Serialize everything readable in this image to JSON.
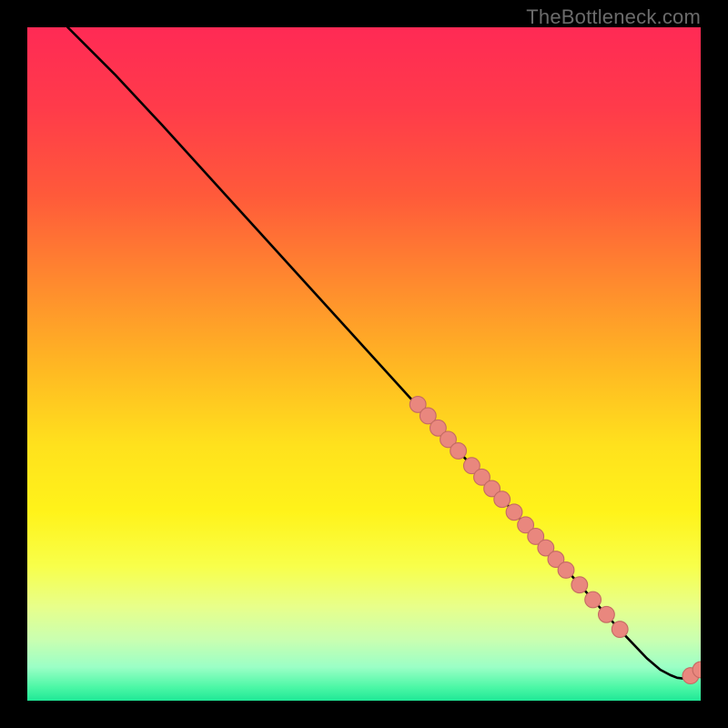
{
  "attribution": "TheBottleneck.com",
  "colors": {
    "background": "#000000",
    "gradient_stops": [
      {
        "offset": 0.0,
        "color": "#ff2a55"
      },
      {
        "offset": 0.12,
        "color": "#ff3b4a"
      },
      {
        "offset": 0.25,
        "color": "#ff5a3a"
      },
      {
        "offset": 0.38,
        "color": "#ff8a2e"
      },
      {
        "offset": 0.5,
        "color": "#ffb623"
      },
      {
        "offset": 0.62,
        "color": "#ffe11d"
      },
      {
        "offset": 0.72,
        "color": "#fff31a"
      },
      {
        "offset": 0.8,
        "color": "#f8ff4a"
      },
      {
        "offset": 0.86,
        "color": "#e8ff8a"
      },
      {
        "offset": 0.91,
        "color": "#c9ffb1"
      },
      {
        "offset": 0.95,
        "color": "#9bffc6"
      },
      {
        "offset": 0.98,
        "color": "#4cf7a6"
      },
      {
        "offset": 1.0,
        "color": "#1fe896"
      }
    ],
    "curve": "#000000",
    "dot_fill": "#e9877e",
    "dot_stroke": "#c46a63"
  },
  "chart_data": {
    "type": "line",
    "title": "",
    "xlabel": "",
    "ylabel": "",
    "xlim": [
      0,
      100
    ],
    "ylim": [
      0,
      100
    ],
    "series": [
      {
        "name": "curve",
        "points": [
          {
            "x": 6,
            "y": 100
          },
          {
            "x": 9,
            "y": 97
          },
          {
            "x": 13,
            "y": 93
          },
          {
            "x": 20,
            "y": 85.5
          },
          {
            "x": 30,
            "y": 74.5
          },
          {
            "x": 40,
            "y": 63.5
          },
          {
            "x": 50,
            "y": 52.5
          },
          {
            "x": 60,
            "y": 41.5
          },
          {
            "x": 70,
            "y": 30.5
          },
          {
            "x": 80,
            "y": 19.5
          },
          {
            "x": 88,
            "y": 10.5
          },
          {
            "x": 92,
            "y": 6.3
          },
          {
            "x": 94,
            "y": 4.6
          },
          {
            "x": 95.5,
            "y": 3.8
          },
          {
            "x": 96.5,
            "y": 3.4
          },
          {
            "x": 97.3,
            "y": 3.3
          },
          {
            "x": 98.2,
            "y": 3.5
          },
          {
            "x": 99.0,
            "y": 3.9
          },
          {
            "x": 100.0,
            "y": 4.6
          }
        ]
      }
    ],
    "dots": [
      {
        "x": 58,
        "y": 44.0,
        "r": 1.2
      },
      {
        "x": 59.5,
        "y": 42.3,
        "r": 1.2
      },
      {
        "x": 61,
        "y": 40.5,
        "r": 1.2
      },
      {
        "x": 62.5,
        "y": 38.8,
        "r": 1.2
      },
      {
        "x": 64,
        "y": 37.1,
        "r": 1.2
      },
      {
        "x": 66,
        "y": 34.9,
        "r": 1.2
      },
      {
        "x": 67.5,
        "y": 33.2,
        "r": 1.2
      },
      {
        "x": 69,
        "y": 31.5,
        "r": 1.2
      },
      {
        "x": 70.5,
        "y": 29.9,
        "r": 1.2
      },
      {
        "x": 72.3,
        "y": 28.0,
        "r": 1.2
      },
      {
        "x": 74,
        "y": 26.1,
        "r": 1.2
      },
      {
        "x": 75.5,
        "y": 24.4,
        "r": 1.2
      },
      {
        "x": 77,
        "y": 22.7,
        "r": 1.2
      },
      {
        "x": 78.5,
        "y": 21.0,
        "r": 1.2
      },
      {
        "x": 80,
        "y": 19.4,
        "r": 1.2
      },
      {
        "x": 82,
        "y": 17.2,
        "r": 1.2
      },
      {
        "x": 84,
        "y": 15.0,
        "r": 1.2
      },
      {
        "x": 86,
        "y": 12.8,
        "r": 1.2
      },
      {
        "x": 88,
        "y": 10.6,
        "r": 1.2
      },
      {
        "x": 98.5,
        "y": 3.7,
        "r": 1.2
      },
      {
        "x": 100,
        "y": 4.6,
        "r": 1.2
      }
    ]
  }
}
